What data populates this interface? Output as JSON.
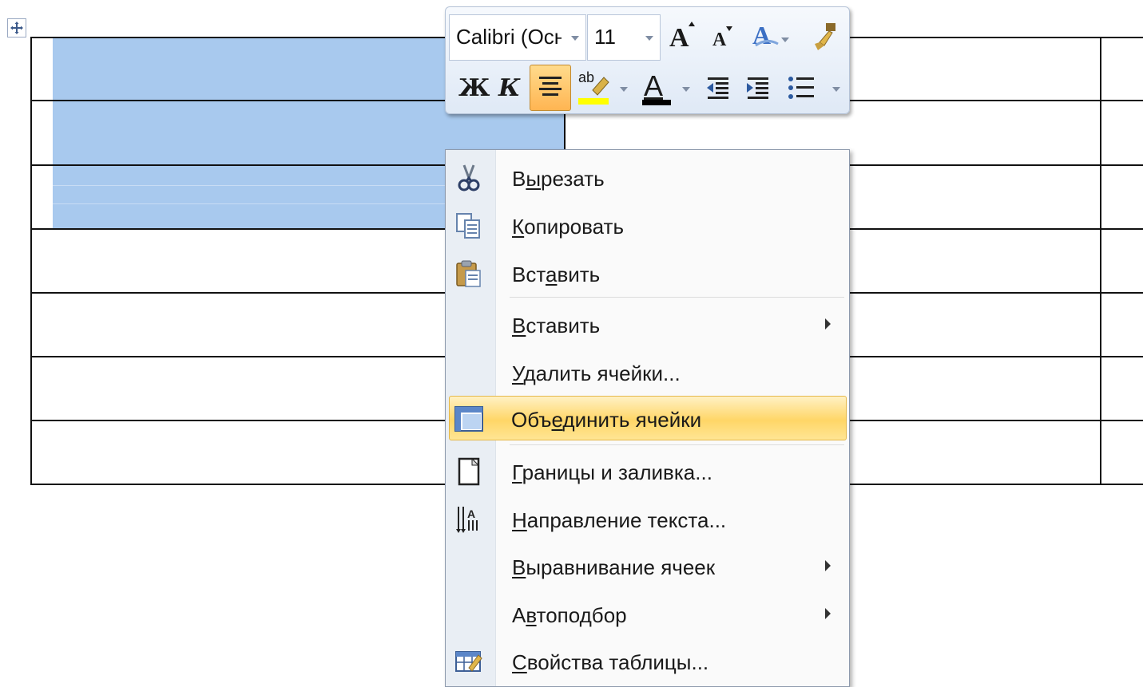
{
  "mini_toolbar": {
    "font_name": "Calibri (Осн",
    "font_size": "11",
    "bold_label": "Ж",
    "italic_label": "К",
    "grow_font_label": "A",
    "shrink_font_label": "A",
    "highlight_label": "ab",
    "font_color_label": "A",
    "highlight_color": "#ffff00",
    "font_color": "#000000"
  },
  "context_menu": {
    "items": [
      {
        "prefix": "В",
        "accel": "ы",
        "suffix": "резать",
        "icon": "scissors-icon"
      },
      {
        "prefix": "",
        "accel": "К",
        "suffix": "опировать",
        "icon": "copy-icon"
      },
      {
        "prefix": "Вст",
        "accel": "а",
        "suffix": "вить",
        "icon": "paste-icon"
      },
      {
        "prefix": "",
        "accel": "В",
        "suffix": "ставить",
        "icon": "",
        "submenu": true
      },
      {
        "prefix": "",
        "accel": "У",
        "suffix": "далить ячейки...",
        "icon": ""
      },
      {
        "prefix": "Объ",
        "accel": "е",
        "suffix": "динить ячейки",
        "icon": "merge-cells-icon",
        "highlighted": true
      },
      {
        "prefix": "",
        "accel": "Г",
        "suffix": "раницы и заливка...",
        "icon": "borders-icon"
      },
      {
        "prefix": "",
        "accel": "Н",
        "suffix": "аправление текста...",
        "icon": "text-direction-icon"
      },
      {
        "prefix": "",
        "accel": "В",
        "suffix": "ыравнивание ячеек",
        "icon": "",
        "submenu": true
      },
      {
        "prefix": "А",
        "accel": "в",
        "suffix": "топодбор",
        "icon": "",
        "submenu": true
      },
      {
        "prefix": "",
        "accel": "С",
        "suffix": "войства таблицы...",
        "icon": "table-properties-icon"
      }
    ]
  },
  "colors": {
    "selection": "#a8c9ee",
    "menu_highlight": "#ffd667"
  }
}
